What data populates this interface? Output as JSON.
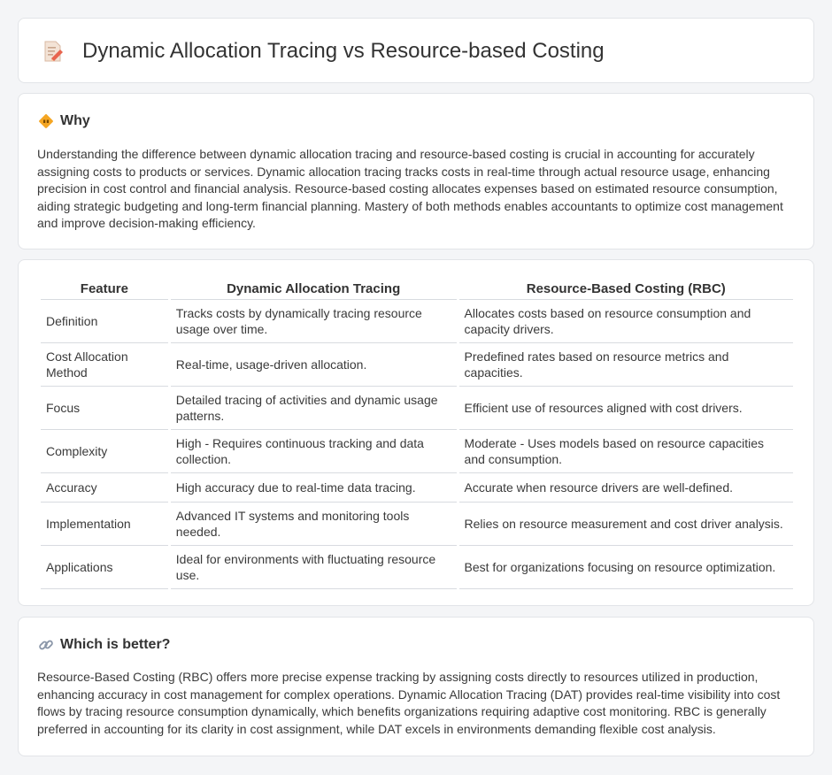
{
  "header": {
    "title": "Dynamic Allocation Tracing vs Resource-based Costing",
    "icon": "document-pencil-icon"
  },
  "why": {
    "title": "Why",
    "icon": "diamond-sign-icon",
    "text": "Understanding the difference between dynamic allocation tracing and resource-based costing is crucial in accounting for accurately assigning costs to products or services. Dynamic allocation tracing tracks costs in real-time through actual resource usage, enhancing precision in cost control and financial analysis. Resource-based costing allocates expenses based on estimated resource consumption, aiding strategic budgeting and long-term financial planning. Mastery of both methods enables accountants to optimize cost management and improve decision-making efficiency."
  },
  "table": {
    "headers": [
      "Feature",
      "Dynamic Allocation Tracing",
      "Resource-Based Costing (RBC)"
    ],
    "rows": [
      [
        "Definition",
        "Tracks costs by dynamically tracing resource usage over time.",
        "Allocates costs based on resource consumption and capacity drivers."
      ],
      [
        "Cost Allocation Method",
        "Real-time, usage-driven allocation.",
        "Predefined rates based on resource metrics and capacities."
      ],
      [
        "Focus",
        "Detailed tracing of activities and dynamic usage patterns.",
        "Efficient use of resources aligned with cost drivers."
      ],
      [
        "Complexity",
        "High - Requires continuous tracking and data collection.",
        "Moderate - Uses models based on resource capacities and consumption."
      ],
      [
        "Accuracy",
        "High accuracy due to real-time data tracing.",
        "Accurate when resource drivers are well-defined."
      ],
      [
        "Implementation",
        "Advanced IT systems and monitoring tools needed.",
        "Relies on resource measurement and cost driver analysis."
      ],
      [
        "Applications",
        "Ideal for environments with fluctuating resource use.",
        "Best for organizations focusing on resource optimization."
      ]
    ]
  },
  "better": {
    "title": "Which is better?",
    "icon": "link-icon",
    "text": "Resource-Based Costing (RBC) offers more precise expense tracking by assigning costs directly to resources utilized in production, enhancing accuracy in cost management for complex operations. Dynamic Allocation Tracing (DAT) provides real-time visibility into cost flows by tracing resource consumption dynamically, which benefits organizations requiring adaptive cost monitoring. RBC is generally preferred in accounting for its clarity in cost assignment, while DAT excels in environments demanding flexible cost analysis."
  }
}
